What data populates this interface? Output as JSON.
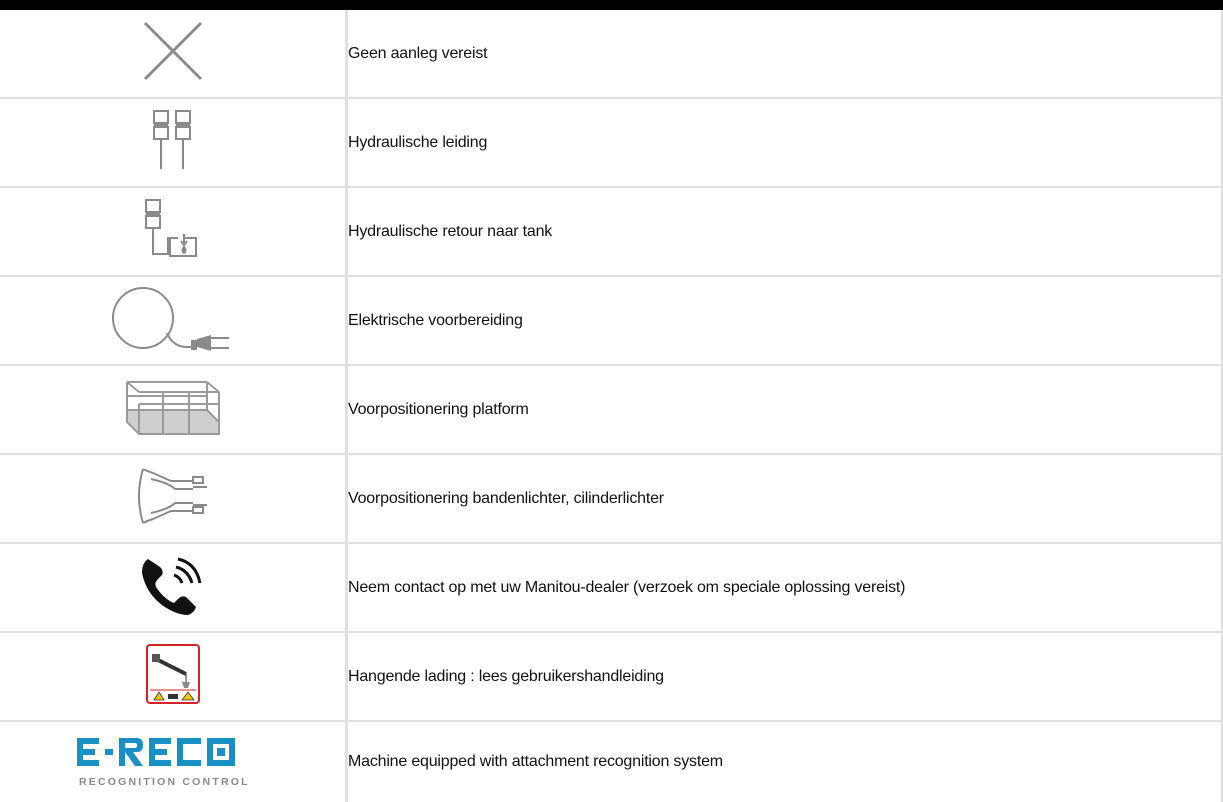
{
  "rows": [
    {
      "icon": "cross-icon",
      "label": "Geen aanleg vereist"
    },
    {
      "icon": "hydraulic-line-icon",
      "label": "Hydraulische leiding"
    },
    {
      "icon": "hydraulic-return-tank-icon",
      "label": "Hydraulische retour naar tank"
    },
    {
      "icon": "electric-plug-icon",
      "label": "Elektrische voorbereiding"
    },
    {
      "icon": "platform-icon",
      "label": "Voorpositionering platform"
    },
    {
      "icon": "tyre-cylinder-handler-icon",
      "label": "Voorpositionering bandenlichter, cilinderlichter"
    },
    {
      "icon": "phone-icon",
      "label": "Neem contact op met uw Manitou-dealer (verzoek om speciale oplossing vereist)"
    },
    {
      "icon": "suspended-load-warning-icon",
      "label": "Hangende lading : lees gebruikershandleiding"
    },
    {
      "icon": "ereco-logo-icon",
      "label": "Machine equipped with attachment recognition system"
    }
  ],
  "logo": {
    "brand": "E-RECO",
    "tagline": "RECOGNITION CONTROL",
    "color": "#1a8fc4"
  },
  "colors": {
    "icon_stroke": "#8a8a8a",
    "border": "#e0e0e0",
    "warning_red": "#d0232a",
    "warning_yellow": "#f5c400"
  }
}
